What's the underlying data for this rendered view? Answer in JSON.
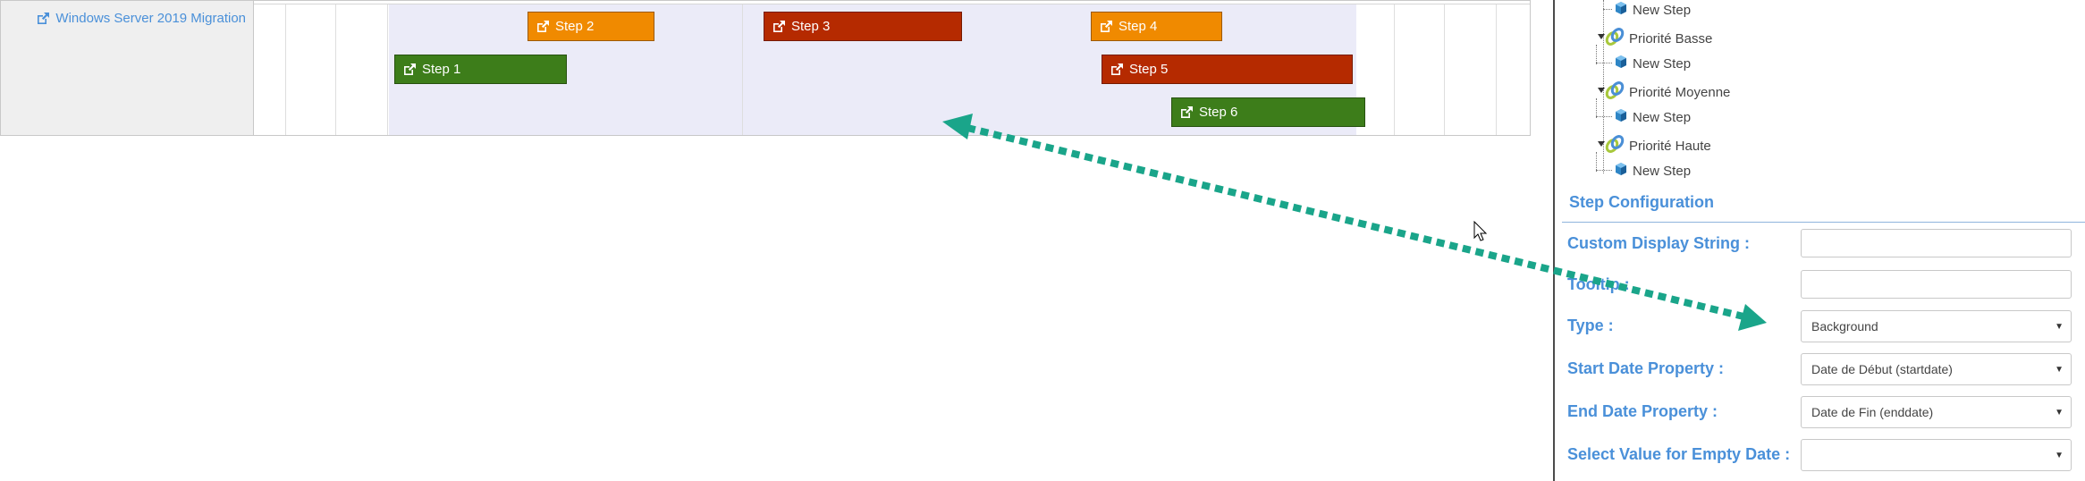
{
  "gantt": {
    "row_label": "Windows Server 2019 Migration",
    "tasks": [
      {
        "label": "Step 2",
        "color": "#f08a00"
      },
      {
        "label": "Step 3",
        "color": "#b52a00"
      },
      {
        "label": "Step 4",
        "color": "#f08a00"
      },
      {
        "label": "Step 1",
        "color": "#3d7d1a"
      },
      {
        "label": "Step 5",
        "color": "#b52a00"
      },
      {
        "label": "Step 6",
        "color": "#3d7d1a"
      }
    ],
    "background_color": "#ebebf8"
  },
  "tree": {
    "items": [
      {
        "label": "New Step",
        "icon": "cube-icon"
      },
      {
        "label": "Priorité Basse",
        "icon": "link-icon"
      },
      {
        "label": "New Step",
        "icon": "cube-icon"
      },
      {
        "label": "Priorité Moyenne",
        "icon": "link-icon"
      },
      {
        "label": "New Step",
        "icon": "cube-icon"
      },
      {
        "label": "Priorité Haute",
        "icon": "link-icon"
      },
      {
        "label": "New Step",
        "icon": "cube-icon"
      }
    ]
  },
  "config": {
    "title": "Step Configuration",
    "fields": {
      "custom_display": {
        "label": "Custom Display String :",
        "value": ""
      },
      "tooltip": {
        "label": "Tooltip :",
        "value": ""
      },
      "type": {
        "label": "Type :",
        "value": "Background"
      },
      "start_date": {
        "label": "Start Date Property :",
        "value": "Date de Début (startdate)"
      },
      "end_date": {
        "label": "End Date Property :",
        "value": "Date de Fin (enddate)"
      },
      "empty_date": {
        "label": "Select Value for Empty Date :",
        "value": ""
      }
    }
  },
  "colors": {
    "accent": "#4a90d9",
    "arrow": "#1aa58a"
  }
}
